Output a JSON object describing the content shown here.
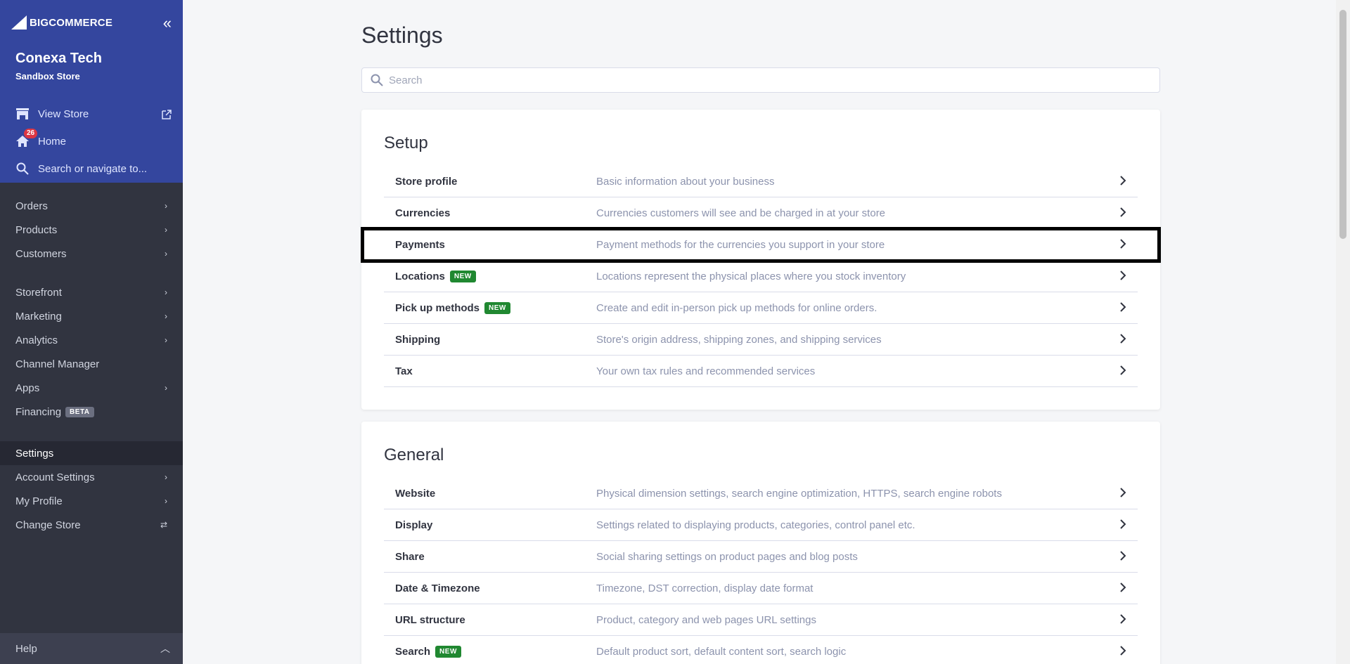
{
  "sidebar": {
    "brand": "BIGCOMMERCE",
    "store_name": "Conexa Tech",
    "store_type": "Sandbox Store",
    "view_store": "View Store",
    "home": "Home",
    "home_badge": "26",
    "search_placeholder": "Search or navigate to...",
    "nav": {
      "orders": "Orders",
      "products": "Products",
      "customers": "Customers",
      "storefront": "Storefront",
      "marketing": "Marketing",
      "analytics": "Analytics",
      "channel_manager": "Channel Manager",
      "apps": "Apps",
      "financing": "Financing",
      "financing_badge": "BETA",
      "settings": "Settings",
      "account_settings": "Account Settings",
      "my_profile": "My Profile",
      "change_store": "Change Store"
    },
    "help": "Help"
  },
  "main": {
    "title": "Settings",
    "search_placeholder": "Search",
    "setup": {
      "title": "Setup",
      "rows": [
        {
          "name": "Store profile",
          "desc": "Basic information about your business"
        },
        {
          "name": "Currencies",
          "desc": "Currencies customers will see and be charged in at your store"
        },
        {
          "name": "Payments",
          "desc": "Payment methods for the currencies you support in your store"
        },
        {
          "name": "Locations",
          "badge": "NEW",
          "desc": "Locations represent the physical places where you stock inventory"
        },
        {
          "name": "Pick up methods",
          "badge": "NEW",
          "desc": "Create and edit in-person pick up methods for online orders."
        },
        {
          "name": "Shipping",
          "desc": "Store's origin address, shipping zones, and shipping services"
        },
        {
          "name": "Tax",
          "desc": "Your own tax rules and recommended services"
        }
      ]
    },
    "general": {
      "title": "General",
      "rows": [
        {
          "name": "Website",
          "desc": "Physical dimension settings, search engine optimization, HTTPS, search engine robots"
        },
        {
          "name": "Display",
          "desc": "Settings related to displaying products, categories, control panel etc."
        },
        {
          "name": "Share",
          "desc": "Social sharing settings on product pages and blog posts"
        },
        {
          "name": "Date & Timezone",
          "desc": "Timezone, DST correction, display date format"
        },
        {
          "name": "URL structure",
          "desc": "Product, category and web pages URL settings"
        },
        {
          "name": "Search",
          "badge": "NEW",
          "desc": "Default product sort, default content sort, search logic"
        }
      ]
    }
  },
  "colors": {
    "sidebar_top": "#34469e",
    "sidebar": "#313440",
    "new_badge": "#208831",
    "home_badge": "#db3643"
  }
}
